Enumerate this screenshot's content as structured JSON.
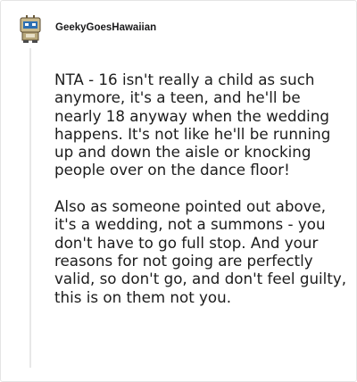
{
  "comment": {
    "author": "GeekyGoesHawaiian",
    "avatar_icon": "robot-avatar-icon",
    "paragraphs": [
      "NTA - 16 isn't really a child as such anymore, it's a teen, and he'll be nearly 18 anyway when the wedding happens. It's not like he'll be running up and down the aisle or knocking people over on the dance floor!",
      "Also as someone pointed out above, it's a wedding, not a summons - you don't have to go full stop. And your reasons for not going are perfectly valid, so don't go, and don't feel guilty, this is on them not you."
    ]
  }
}
